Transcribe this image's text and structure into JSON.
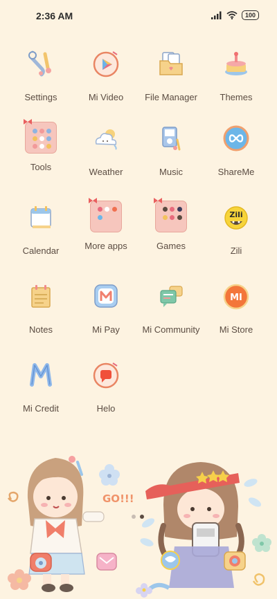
{
  "status_bar": {
    "time": "2:36 AM",
    "battery": "100",
    "icons": [
      "signal-icon",
      "wifi-icon",
      "battery-icon"
    ]
  },
  "apps": [
    {
      "label": "Settings",
      "icon": "settings-icon"
    },
    {
      "label": "Mi Video",
      "icon": "play-icon"
    },
    {
      "label": "File Manager",
      "icon": "folder-file-icon"
    },
    {
      "label": "Themes",
      "icon": "cake-icon"
    },
    {
      "label": "Tools",
      "icon": "folder-icon"
    },
    {
      "label": "Weather",
      "icon": "cloud-icon"
    },
    {
      "label": "Music",
      "icon": "music-player-icon"
    },
    {
      "label": "ShareMe",
      "icon": "infinity-icon"
    },
    {
      "label": "Calendar",
      "icon": "calendar-icon"
    },
    {
      "label": "More apps",
      "icon": "folder-icon"
    },
    {
      "label": "Games",
      "icon": "folder-icon"
    },
    {
      "label": "Zili",
      "icon": "zili-icon"
    },
    {
      "label": "Notes",
      "icon": "notes-icon"
    },
    {
      "label": "Mi Pay",
      "icon": "mi-pay-icon"
    },
    {
      "label": "Mi Community",
      "icon": "chat-bubbles-icon"
    },
    {
      "label": "Mi Store",
      "icon": "mi-store-icon"
    },
    {
      "label": "Mi Credit",
      "icon": "mi-credit-icon"
    },
    {
      "label": "Helo",
      "icon": "helo-icon"
    }
  ],
  "wallpaper": {
    "text": "GO!!!"
  },
  "page_indicator": {
    "pages": 2,
    "active": 2
  }
}
